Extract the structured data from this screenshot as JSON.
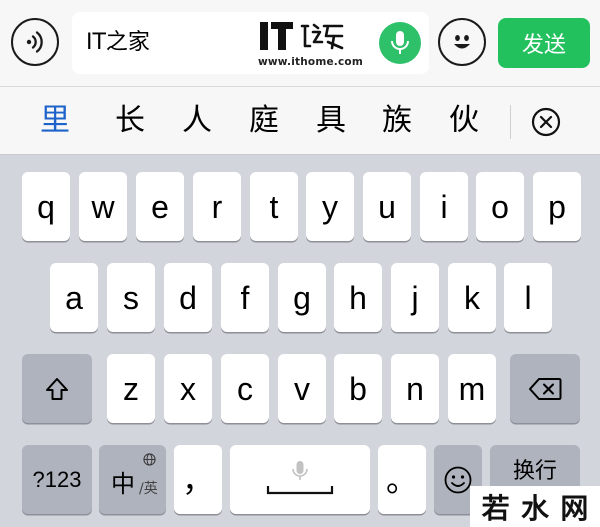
{
  "input_bar": {
    "text_value": "IT之家",
    "watermark_url": "www.ithome.com",
    "send_label": "发送"
  },
  "candidates": [
    "里",
    "长",
    "人",
    "庭",
    "具",
    "族",
    "伙"
  ],
  "keyboard": {
    "row1": [
      "q",
      "w",
      "e",
      "r",
      "t",
      "y",
      "u",
      "i",
      "o",
      "p"
    ],
    "row2": [
      "a",
      "s",
      "d",
      "f",
      "g",
      "h",
      "j",
      "k",
      "l"
    ],
    "row3": [
      "z",
      "x",
      "c",
      "v",
      "b",
      "n",
      "m"
    ],
    "numbers_label": "?123",
    "lang_primary": "中",
    "lang_secondary": "/英",
    "comma_label": "，",
    "period_label": "。",
    "return_label": "换行"
  },
  "corner_watermark": {
    "text": [
      "若",
      "水",
      "网"
    ]
  },
  "colors": {
    "send_green": "#22c15e",
    "mic_green": "#2fc16a",
    "candidate_highlight": "#1d63c9",
    "keyboard_bg": "#d3d5dc",
    "dark_key": "#aeb3bd"
  }
}
